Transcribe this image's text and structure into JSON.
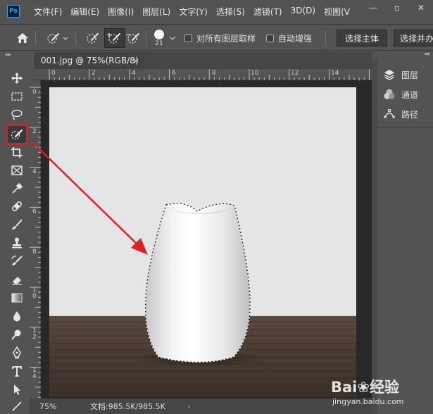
{
  "app": {
    "logo_text": "Ps"
  },
  "menu": [
    "文件(F)",
    "编辑(E)",
    "图像(I)",
    "图层(L)",
    "文字(Y)",
    "选择(S)",
    "滤镜(T)",
    "3D(D)",
    "视图(V"
  ],
  "window_controls": {
    "minimize": "—",
    "restore": "▫",
    "close": "✕"
  },
  "options_bar": {
    "brush_size": "21",
    "sample_all_layers_label": "对所有图层取样",
    "auto_enhance_label": "自动增强",
    "select_subject_label": "选择主体",
    "select_and_mask_label": "选择并办"
  },
  "document_tab": {
    "title": "001.jpg @ 75%(RGB/8)",
    "close": "×"
  },
  "ruler_h_labels": [
    "0",
    "2",
    "4",
    "6",
    "8",
    "10",
    "12",
    "14"
  ],
  "ruler_v_labels": [
    "0",
    "2",
    "4",
    "6",
    "8",
    "1\n0",
    "1\n2",
    "1\n4"
  ],
  "status_bar": {
    "zoom": "75%",
    "doc_size": "文档:985.5K/985.5K",
    "arrow": "›"
  },
  "panels": [
    {
      "icon": "layers-icon",
      "label": "图层"
    },
    {
      "icon": "channels-icon",
      "label": "通道"
    },
    {
      "icon": "paths-icon",
      "label": "路径"
    }
  ],
  "watermark": {
    "logo": "Bai❀经验",
    "url": "jingyan.baidu.com"
  },
  "colors": {
    "annotation": "#e02020",
    "accent": "#31a8ff"
  }
}
